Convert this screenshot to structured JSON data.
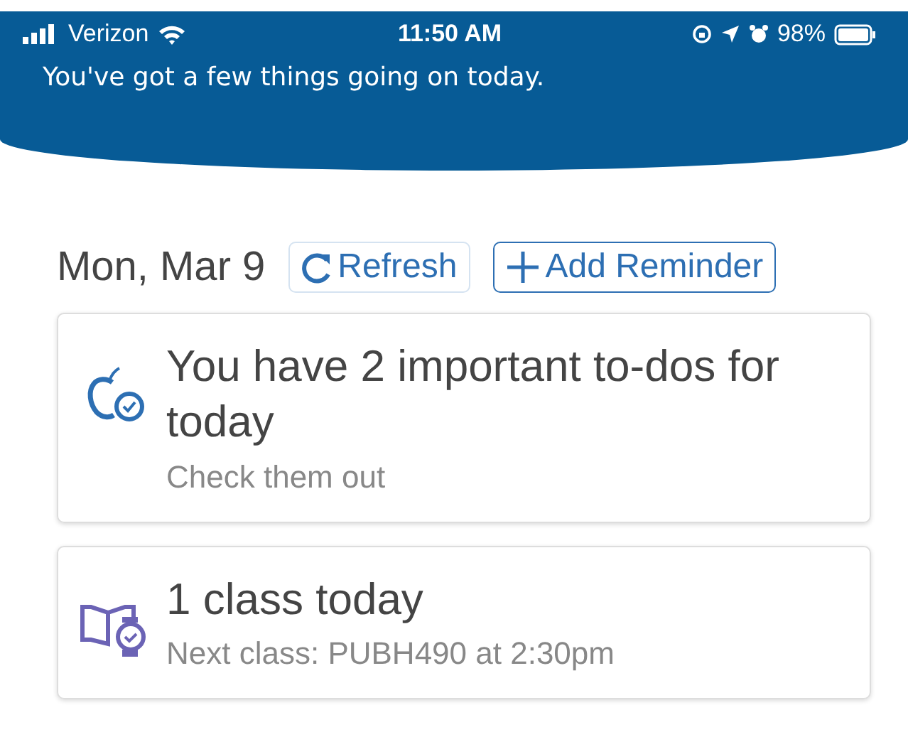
{
  "status_bar": {
    "carrier": "Verizon",
    "time": "11:50 AM",
    "battery": "98%"
  },
  "header": {
    "message": "You've got a few things going on today."
  },
  "date": "Mon, Mar 9",
  "buttons": [
    {
      "kind": "refresh",
      "label": "Refresh"
    },
    {
      "kind": "add",
      "label": "Add Reminder"
    }
  ],
  "cards": [
    {
      "kind": "todo",
      "title": "You have 2 important to-dos for today",
      "subtitle": "Check them out"
    },
    {
      "kind": "class",
      "title": "1 class today",
      "subtitle": "Next class: PUBH490 at 2:30pm"
    }
  ]
}
